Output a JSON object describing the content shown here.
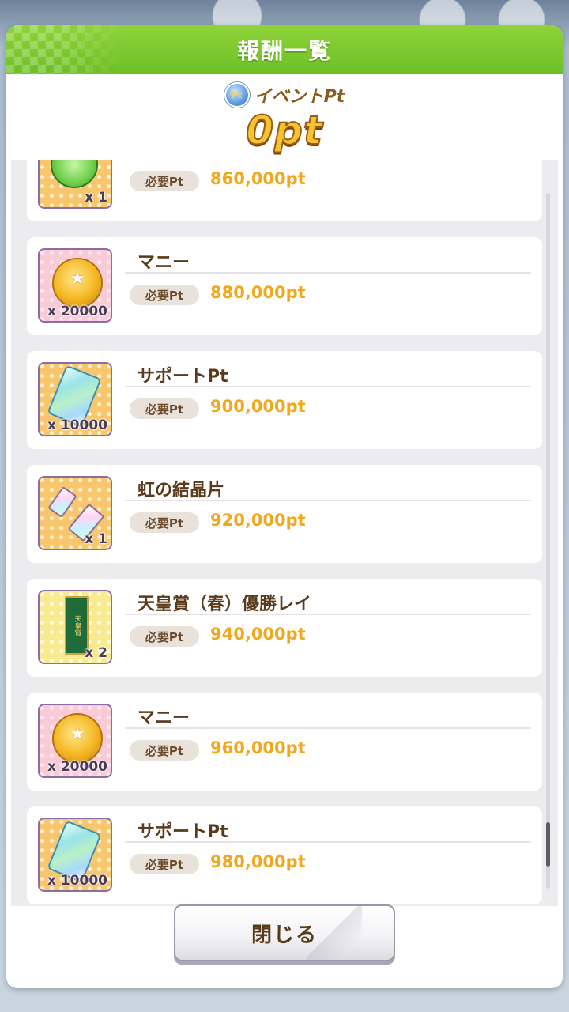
{
  "dialog": {
    "title": "報酬一覧",
    "points_label": "イベントPt",
    "points_icon_text": "Pt",
    "points_value": "0pt",
    "close_label": "閉じる"
  },
  "rewards": [
    {
      "name": "",
      "req_label": "必要Pt",
      "req_value": "860,000pt",
      "qty": "x 1",
      "icon": "gem-icon"
    },
    {
      "name": "マニー",
      "req_label": "必要Pt",
      "req_value": "880,000pt",
      "qty": "x 20000",
      "icon": "coin-icon"
    },
    {
      "name": "サポートPt",
      "req_label": "必要Pt",
      "req_value": "900,000pt",
      "qty": "x 10000",
      "icon": "support-card-icon"
    },
    {
      "name": "虹の結晶片",
      "req_label": "必要Pt",
      "req_value": "920,000pt",
      "qty": "x 1",
      "icon": "crystal-icon"
    },
    {
      "name": "天皇賞（春）優勝レイ",
      "req_label": "必要Pt",
      "req_value": "940,000pt",
      "qty": "x 2",
      "icon": "lei-icon",
      "icon_text": "天皇賞"
    },
    {
      "name": "マニー",
      "req_label": "必要Pt",
      "req_value": "960,000pt",
      "qty": "x 20000",
      "icon": "coin-icon"
    },
    {
      "name": "サポートPt",
      "req_label": "必要Pt",
      "req_value": "980,000pt",
      "qty": "x 10000",
      "icon": "support-card-icon"
    }
  ]
}
